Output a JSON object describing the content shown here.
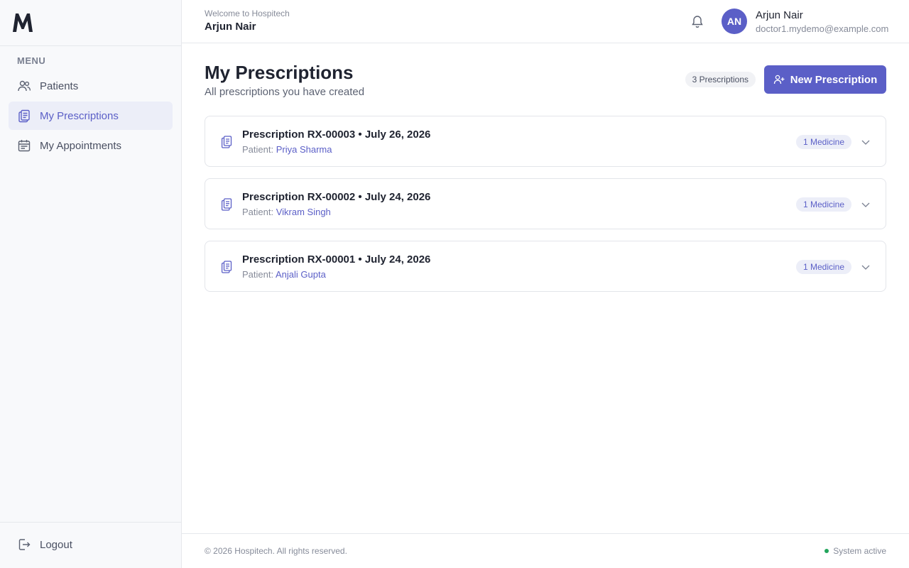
{
  "app": {
    "logo_letter": "M"
  },
  "sidebar": {
    "menu_title": "MENU",
    "items": [
      {
        "label": "Patients",
        "icon": "users-icon",
        "active": false
      },
      {
        "label": "My Prescriptions",
        "icon": "clipboard-icon",
        "active": true
      },
      {
        "label": "My Appointments",
        "icon": "calendar-icon",
        "active": false
      }
    ],
    "logout_label": "Logout"
  },
  "header": {
    "welcome": "Welcome to Hospitech",
    "welcome_name": "Arjun Nair",
    "user": {
      "initials": "AN",
      "name": "Arjun Nair",
      "email": "doctor1.mydemo@example.com"
    }
  },
  "main": {
    "title": "My Prescriptions",
    "subtitle": "All prescriptions you have created",
    "count_badge": "3 Prescriptions",
    "new_button": "New Prescription",
    "prescriptions": [
      {
        "title": "Prescription RX-00003 • July 26, 2026",
        "patient_label": "Patient:",
        "patient_name": "Priya Sharma",
        "badge": "1 Medicine"
      },
      {
        "title": "Prescription RX-00002 • July 24, 2026",
        "patient_label": "Patient:",
        "patient_name": "Vikram Singh",
        "badge": "1 Medicine"
      },
      {
        "title": "Prescription RX-00001 • July 24, 2026",
        "patient_label": "Patient:",
        "patient_name": "Anjali Gupta",
        "badge": "1 Medicine"
      }
    ]
  },
  "footer": {
    "copyright": "© 2026 Hospitech. All rights reserved.",
    "status": "System active"
  },
  "colors": {
    "accent": "#5b5fc7",
    "status_active": "#22a55b"
  }
}
